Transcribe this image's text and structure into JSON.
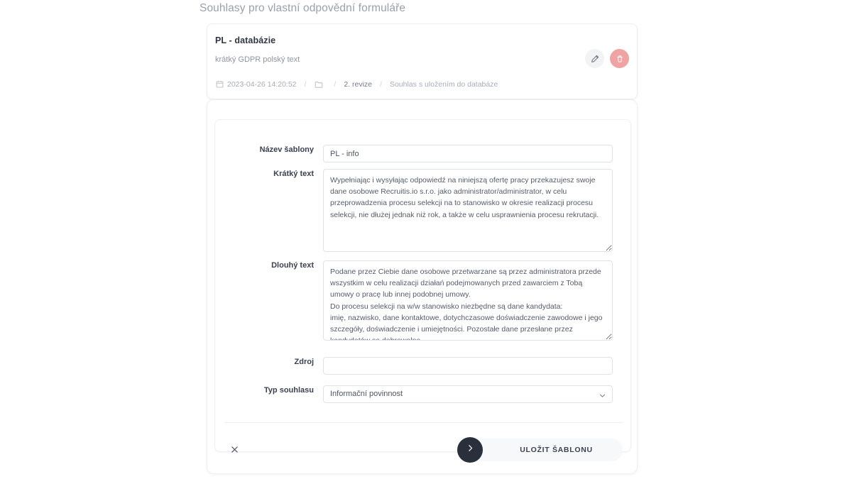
{
  "page": {
    "title": "Souhlasy pro vlastní odpovědní formuláře"
  },
  "summary_card": {
    "title": "PL - databázie",
    "subtitle": "krátký GDPR polský text",
    "meta": {
      "calendar_icon": "calendar-icon",
      "date": "2023-04-26 14:20:52",
      "separator": "/",
      "folder_icon": "folder-icon",
      "revision": "2. revize",
      "consent_type": "Souhlas s uložením do databáze"
    },
    "actions": {
      "edit_icon": "pencil-icon",
      "delete_icon": "trash-icon",
      "edit_bg": "#f2f3f5",
      "delete_bg": "#f0a3a3"
    }
  },
  "form": {
    "fields": {
      "template_name": {
        "label": "Název šablony",
        "value": "PL - info",
        "placeholder": ""
      },
      "short_text": {
        "label": "Krátký text",
        "value": "Wypełniając i wysyłając odpowiedź na niniejszą ofertę pracy przekazujesz swoje dane osobowe Recruitis.io s.r.o. jako administrator/administrator, w celu przeprowadzenia procesu selekcji na to stanowisko w okresie realizacji procesu selekcji, nie dłużej jednak niż rok, a także w celu usprawnienia procesu rekrutacji.",
        "placeholder": ""
      },
      "long_text": {
        "label": "Dlouhý text",
        "value": "Podane przez Ciebie dane osobowe przetwarzane są przez administratora przede wszystkim w celu realizacji działań podejmowanych przed zawarciem z Tobą umowy o pracę lub innej podobnej umowy.\nDo procesu selekcji na w/w stanowisko niezbędne są dane kandydata:\nimię, nazwisko, dane kontaktowe, dotychczasowe doświadczenie zawodowe i jego szczegóły, doświadczenie i umiejętności. Pozostałe dane przesłane przez kandydatów są dobrowolne.",
        "placeholder": ""
      },
      "source": {
        "label": "Zdroj",
        "value": "",
        "placeholder": ""
      },
      "consent_type": {
        "label": "Typ souhlasu",
        "value": "Informační povinnost",
        "options": [
          "Informační povinnost"
        ]
      }
    },
    "footer": {
      "close_icon": "close-icon",
      "submit_icon": "chevron-right-icon",
      "submit_label": "ULOŽIT ŠABLONU",
      "submit_circle_color": "#2a2f3c"
    }
  }
}
